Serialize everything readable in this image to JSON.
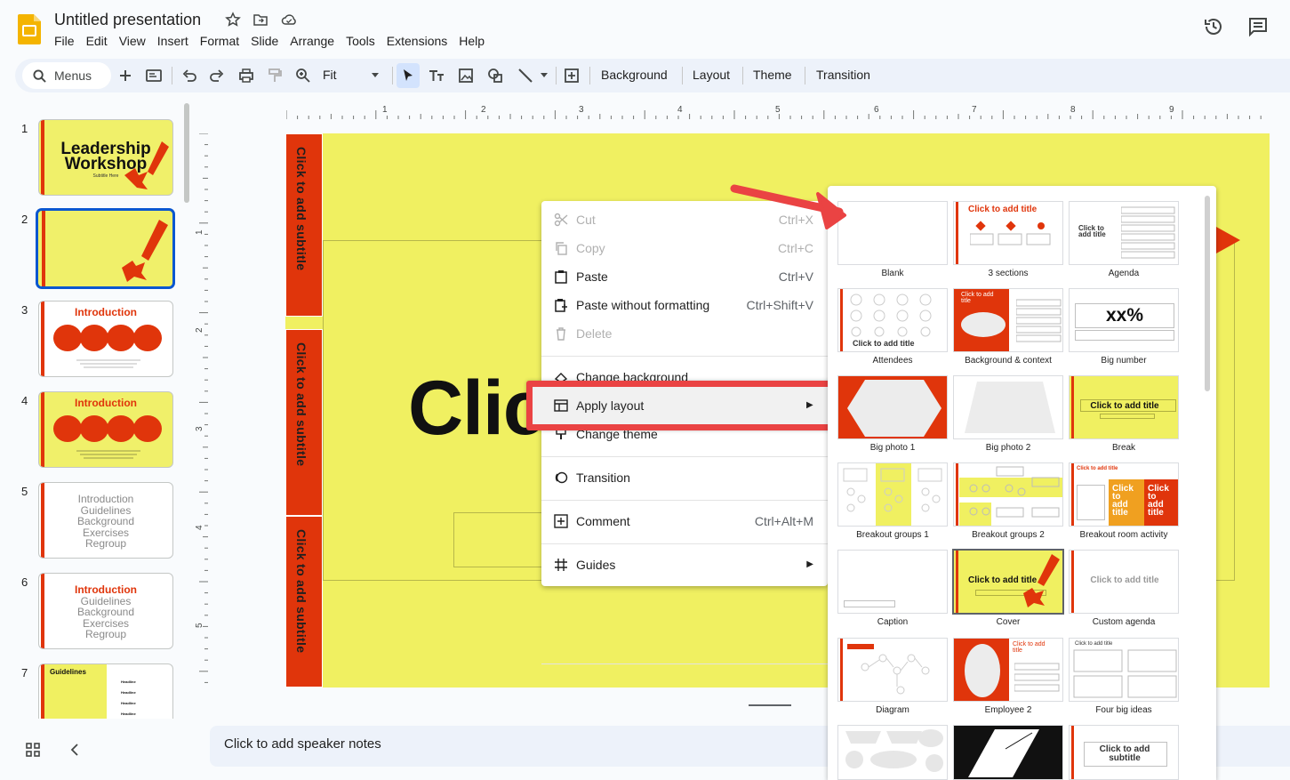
{
  "header": {
    "title": "Untitled presentation",
    "menus": [
      "File",
      "Edit",
      "View",
      "Insert",
      "Format",
      "Slide",
      "Arrange",
      "Tools",
      "Extensions",
      "Help"
    ]
  },
  "toolbar": {
    "menus_label": "Menus",
    "zoom": "Fit",
    "background": "Background",
    "layout": "Layout",
    "theme": "Theme",
    "transition": "Transition"
  },
  "filmstrip": {
    "slides": [
      {
        "num": "1",
        "title": "Leadership Workshop",
        "subtitle": "Subtitle Here"
      },
      {
        "num": "2",
        "title": ""
      },
      {
        "num": "3",
        "title": "Introduction"
      },
      {
        "num": "4",
        "title": "Introduction"
      },
      {
        "num": "5",
        "lines": [
          "Introduction",
          "Guidelines",
          "Background",
          "Exercises",
          "Regroup"
        ]
      },
      {
        "num": "6",
        "lines": [
          "Introduction",
          "Guidelines",
          "Background",
          "Exercises",
          "Regroup"
        ]
      },
      {
        "num": "7",
        "title": "Guidelines",
        "items": [
          "Headline",
          "Headline",
          "Headline",
          "Headline"
        ]
      }
    ]
  },
  "ruler": {
    "h": [
      "1",
      "2",
      "3",
      "4",
      "5",
      "6",
      "7",
      "8",
      "9"
    ],
    "v": [
      "1",
      "2",
      "3",
      "4",
      "5"
    ]
  },
  "slide": {
    "side_text": [
      "Click to add subtitle",
      "Click to add subtitle",
      "Click to add subtitle"
    ],
    "big_text": "Clic"
  },
  "notes": {
    "placeholder": "Click to add speaker notes"
  },
  "context_menu": {
    "items": [
      {
        "label": "Cut",
        "shortcut": "Ctrl+X"
      },
      {
        "label": "Copy",
        "shortcut": "Ctrl+C"
      },
      {
        "label": "Paste",
        "shortcut": "Ctrl+V"
      },
      {
        "label": "Paste without formatting",
        "shortcut": "Ctrl+Shift+V"
      },
      {
        "label": "Delete",
        "shortcut": ""
      },
      {
        "label": "Change background",
        "shortcut": ""
      },
      {
        "label": "Apply layout",
        "shortcut": ""
      },
      {
        "label": "Change theme",
        "shortcut": ""
      },
      {
        "label": "Transition",
        "shortcut": ""
      },
      {
        "label": "Comment",
        "shortcut": "Ctrl+Alt+M"
      },
      {
        "label": "Guides",
        "shortcut": ""
      }
    ]
  },
  "layouts": {
    "names": [
      "Blank",
      "3 sections",
      "Agenda",
      "Attendees",
      "Background & context",
      "Big number",
      "Big photo 1",
      "Big photo 2",
      "Break",
      "Breakout groups 1",
      "Breakout groups 2",
      "Breakout room activity",
      "Caption",
      "Cover",
      "Custom agenda",
      "Diagram",
      "Employee 2",
      "Four big ideas"
    ],
    "thumb_text": {
      "click_title": "Click to add title",
      "click_to_add_title": "Click to add title",
      "click_to": "Click to",
      "add_title": "add title",
      "click_add": "Click to add",
      "title": "title",
      "big_number": "xx%",
      "click_add_subtitle_1": "Click to add",
      "click_add_subtitle_2": "subtitle",
      "click": "Click",
      "to": "to",
      "add": "add"
    }
  },
  "colors": {
    "slide_yellow": "#f0f061",
    "slide_red": "#e0350b",
    "highlight_red": "#ea4343",
    "accent_blue": "#0b57d0"
  }
}
